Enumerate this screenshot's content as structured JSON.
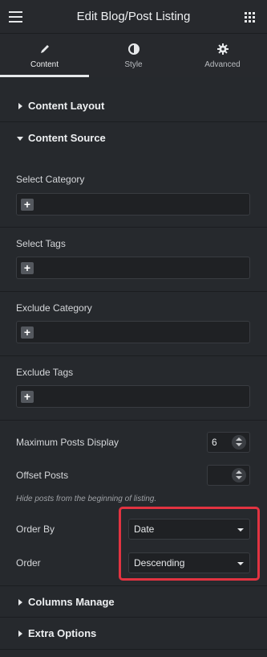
{
  "header": {
    "title": "Edit Blog/Post Listing"
  },
  "tabs": [
    {
      "label": "Content",
      "icon": "pencil-icon",
      "active": true
    },
    {
      "label": "Style",
      "icon": "contrast-icon",
      "active": false
    },
    {
      "label": "Advanced",
      "icon": "gear-icon",
      "active": false
    }
  ],
  "sections": {
    "content_layout": "Content Layout",
    "content_source": "Content Source",
    "columns_manage": "Columns Manage",
    "extra_options": "Extra Options"
  },
  "content_source": {
    "select_category": "Select Category",
    "select_tags": "Select Tags",
    "exclude_category": "Exclude Category",
    "exclude_tags": "Exclude Tags",
    "add_symbol": "+",
    "max_posts_label": "Maximum Posts Display",
    "max_posts_value": "6",
    "offset_label": "Offset Posts",
    "offset_value": "",
    "offset_hint": "Hide posts from the beginning of listing.",
    "order_by_label": "Order By",
    "order_by_value": "Date",
    "order_label": "Order",
    "order_value": "Descending"
  },
  "colors": {
    "highlight": "#e23341",
    "panel_bg": "#26292d"
  }
}
